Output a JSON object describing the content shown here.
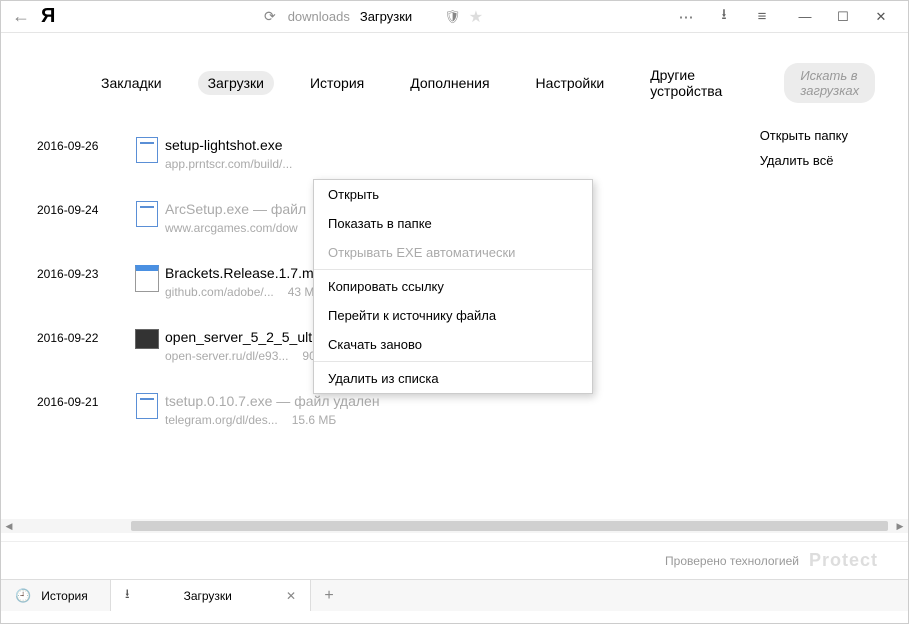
{
  "titlebar": {
    "logo": "Я",
    "address_label": "downloads",
    "address_title": "Загрузки"
  },
  "tabs": {
    "items": [
      "Закладки",
      "Загрузки",
      "История",
      "Дополнения",
      "Настройки",
      "Другие устройства"
    ],
    "active_index": 1,
    "search_placeholder": "Искать в загрузках"
  },
  "side_actions": {
    "open_folder": "Открыть папку",
    "delete_all": "Удалить всё"
  },
  "downloads": [
    {
      "date": "2016-09-26",
      "name": "setup-lightshot.exe",
      "source": "app.prntscr.com/build/...",
      "size": "",
      "icon": "generic",
      "deleted": false
    },
    {
      "date": "2016-09-24",
      "name": "ArcSetup.exe — файл",
      "source": "www.arcgames.com/dow",
      "size": "",
      "icon": "generic",
      "deleted": true
    },
    {
      "date": "2016-09-23",
      "name": "Brackets.Release.1.7.m",
      "source": "github.com/adobe/...",
      "size": "43 МБ",
      "icon": "app",
      "deleted": false
    },
    {
      "date": "2016-09-22",
      "name": "open_server_5_2_5_ultimate.exe",
      "source": "open-server.ru/dl/e93...",
      "size": "903 МБ",
      "icon": "cmd",
      "deleted": false
    },
    {
      "date": "2016-09-21",
      "name": "tsetup.0.10.7.exe — файл удален",
      "source": "telegram.org/dl/des...",
      "size": "15.6 МБ",
      "icon": "generic",
      "deleted": true
    }
  ],
  "context_menu": {
    "open": "Открыть",
    "show_in_folder": "Показать в папке",
    "auto_open_exe": "Открывать EXE автоматически",
    "copy_link": "Копировать ссылку",
    "go_to_source": "Перейти к источнику файла",
    "redownload": "Скачать заново",
    "remove": "Удалить из списка"
  },
  "status": {
    "checked_by": "Проверено технологией",
    "brand": "Protect"
  },
  "bottom_tabs": {
    "history": "История",
    "downloads": "Загрузки"
  }
}
